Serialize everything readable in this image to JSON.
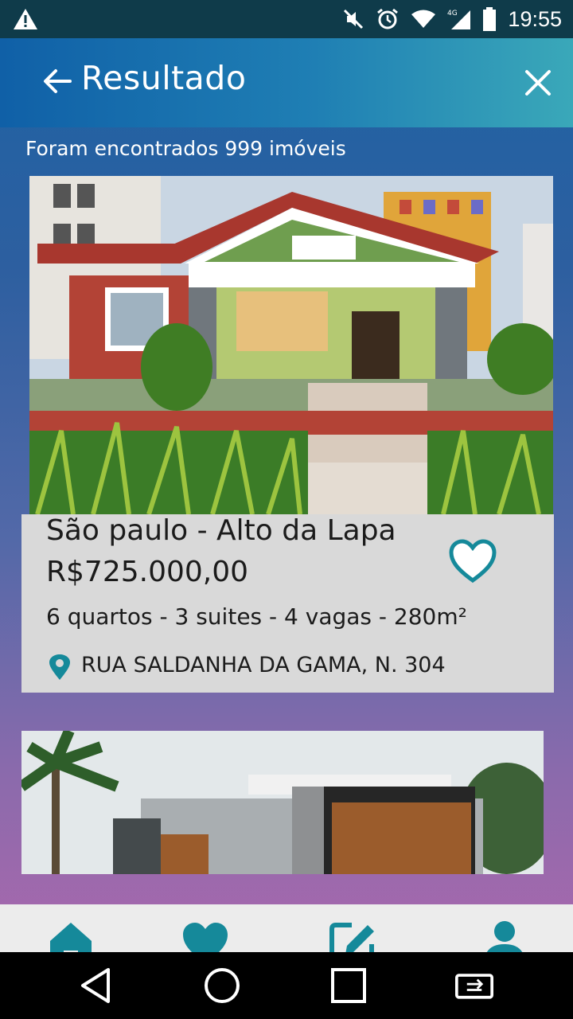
{
  "status": {
    "time": "19:55",
    "network": "4G"
  },
  "header": {
    "title": "Resultado"
  },
  "results": {
    "count_text": "Foram encontrados 999 imóveis"
  },
  "listings": [
    {
      "title": "São paulo - Alto da Lapa",
      "price": "R$725.000,00",
      "specs": "6 quartos - 3 suites - 4 vagas - 280m²",
      "address": "RUA SALDANHA DA GAMA, N. 304"
    }
  ],
  "colors": {
    "accent": "#15899a",
    "appbar_start": "#1060a7",
    "appbar_end": "#3aa8b9",
    "card": "#d9d9d9",
    "tabbar": "#ececec"
  },
  "icons": {
    "status": [
      "warning-icon",
      "mute-icon",
      "alarm-icon",
      "wifi-icon",
      "signal-icon",
      "battery-icon"
    ],
    "tabs": [
      "home-icon",
      "heart-icon",
      "edit-icon",
      "user-icon"
    ],
    "nav": [
      "back-nav-icon",
      "home-nav-icon",
      "recents-nav-icon",
      "rotate-icon"
    ]
  }
}
